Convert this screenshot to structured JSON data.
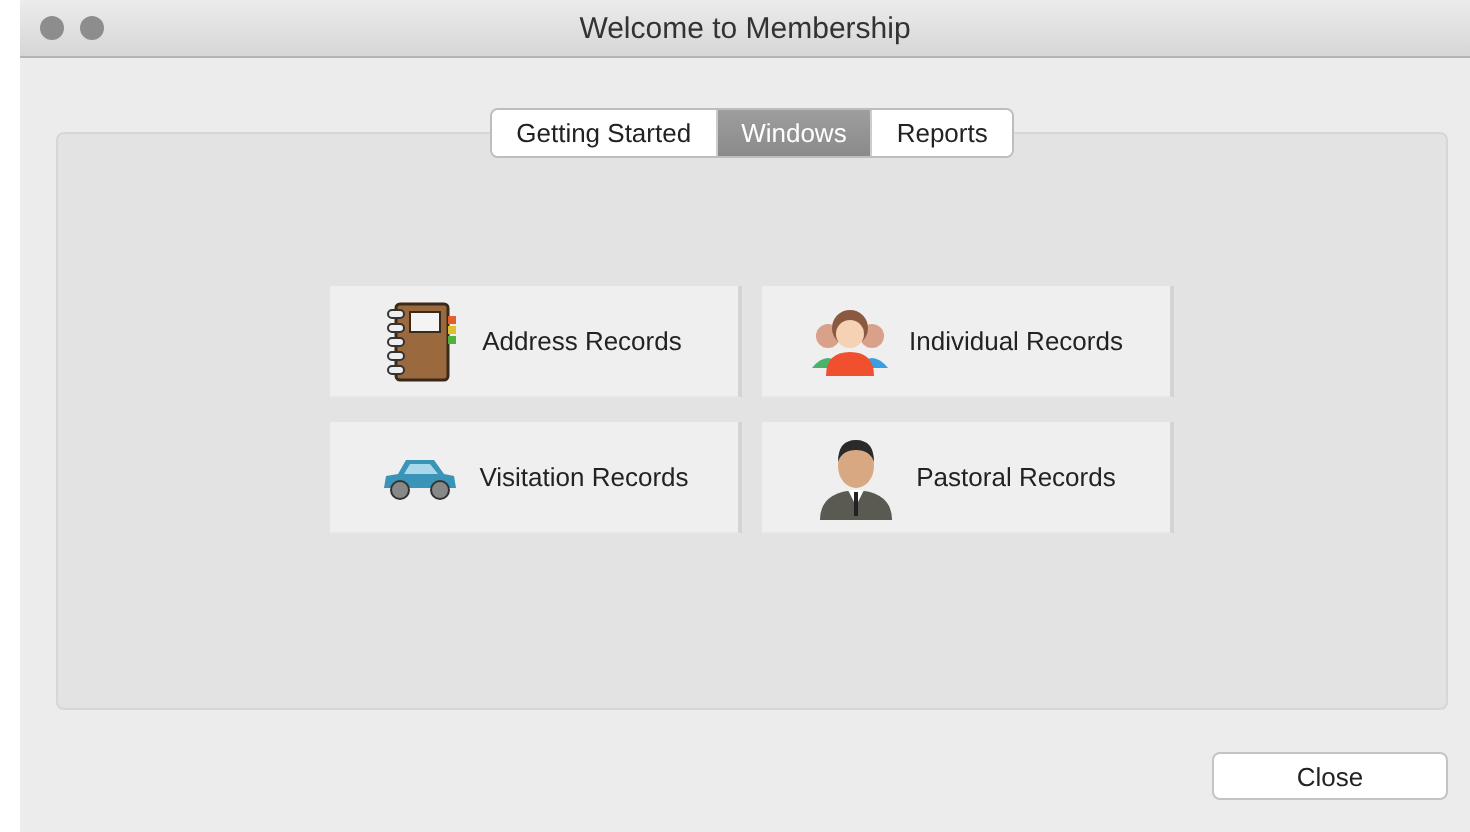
{
  "window": {
    "title": "Welcome to Membership"
  },
  "tabs": [
    {
      "label": "Getting Started",
      "selected": false
    },
    {
      "label": "Windows",
      "selected": true
    },
    {
      "label": "Reports",
      "selected": false
    }
  ],
  "tiles": [
    {
      "label": "Address Records",
      "kind": "notebook"
    },
    {
      "label": "Individual Records",
      "kind": "group"
    },
    {
      "label": "Visitation Records",
      "kind": "car"
    },
    {
      "label": "Pastoral Records",
      "kind": "person"
    }
  ],
  "buttons": [
    "Close"
  ]
}
